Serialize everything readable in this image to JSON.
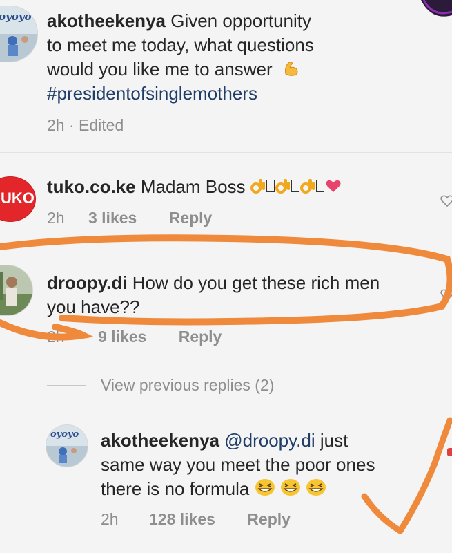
{
  "post": {
    "username": "akotheekenya",
    "caption_line1": "Given opportunity",
    "caption_line2": "to meet me today,  what questions",
    "caption_line3": "would you like me to answer",
    "hashtag": "#presidentofsinglemothers",
    "time": "2h",
    "edited": "Edited",
    "avatar_logo": "oyoyo"
  },
  "comments": [
    {
      "username": "tuko.co.ke",
      "text": "Madam Boss",
      "time": "2h",
      "likes": "3 likes",
      "reply": "Reply",
      "avatar_logo": "UKO",
      "emoji": [
        "ok-hand",
        "box",
        "ok-hand",
        "box",
        "ok-hand",
        "box",
        "heart"
      ]
    },
    {
      "username": "droopy.di",
      "text_line1": "How do you get these rich men",
      "text_line2": "you have??",
      "time": "2h",
      "likes": "9 likes",
      "reply": "Reply",
      "highlight_color": "#ef8a3c"
    }
  ],
  "view_previous": "View previous replies (2)",
  "reply": {
    "username": "akotheekenya",
    "mention": "@droopy.di",
    "line1": "just",
    "line2": "same way you meet the poor ones",
    "line3": "there is no formula",
    "time": "2h",
    "likes": "128 likes",
    "reply": "Reply",
    "avatar_logo": "oyoyo",
    "emoji": [
      "grinning-squinting",
      "grinning-squinting",
      "grinning-squinting"
    ]
  },
  "colors": {
    "background": "#f4f4f4",
    "annotation": "#ef8a3c",
    "hashtag": "#1f3d66",
    "meta": "#8e8e8e",
    "tuko_red": "#e3262a"
  }
}
